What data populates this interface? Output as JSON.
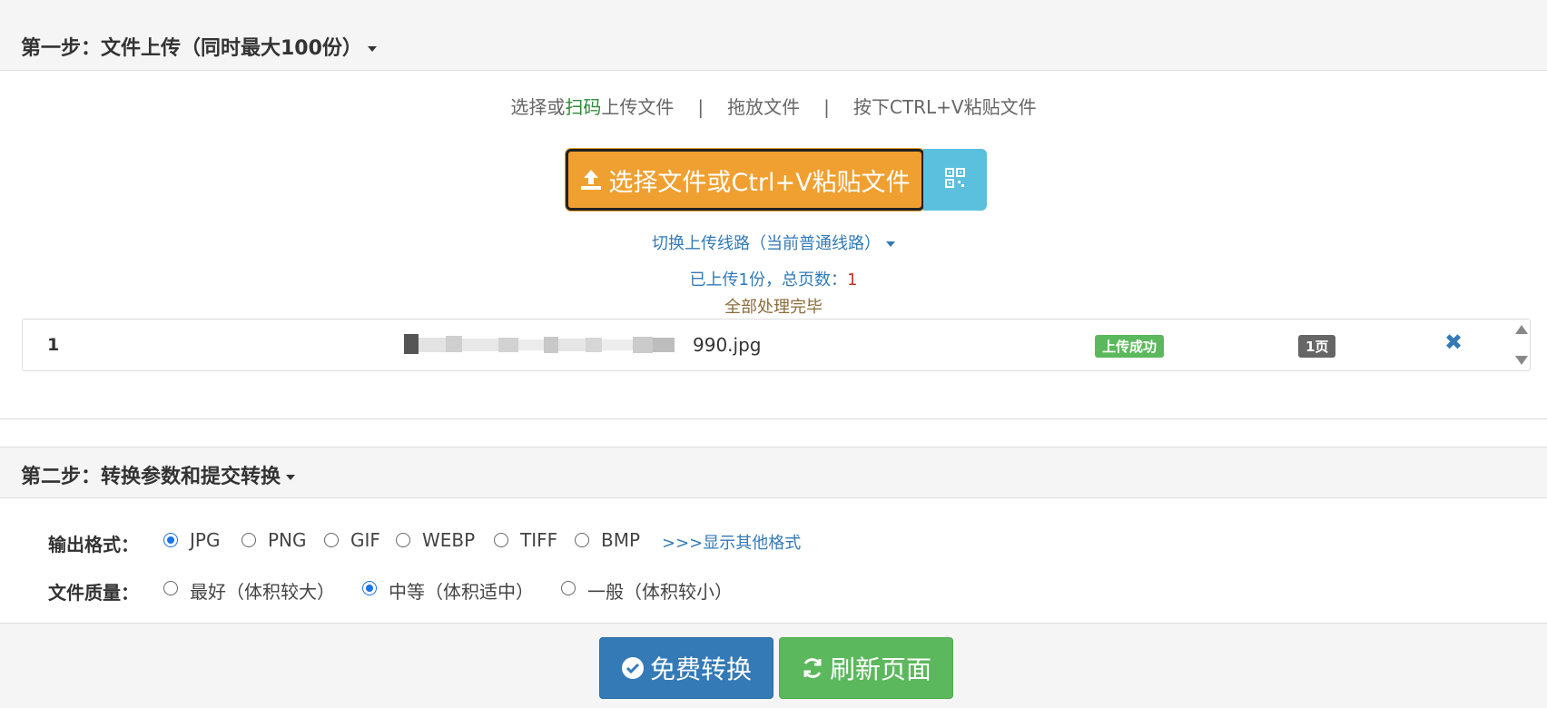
{
  "step1": {
    "title": "第一步：文件上传（同时最大100份）",
    "modes": {
      "choose_prefix": "选择或",
      "scan": "扫码",
      "choose_suffix": "上传文件",
      "sep": "|",
      "drop": "拖放文件",
      "paste": "按下CTRL+V粘贴文件"
    },
    "upload_button": "选择文件或Ctrl+V粘贴文件",
    "switch_line": "切换上传线路（当前普通线路）",
    "upload_status": {
      "prefix": "已上传",
      "count": "1",
      "mid": "份，总页数：",
      "pages": "1"
    },
    "all_done": "全部处理完毕",
    "files": [
      {
        "index": "1",
        "name_suffix": "990.jpg",
        "status": "上传成功",
        "pages": "1页"
      }
    ]
  },
  "step2": {
    "title": "第二步：转换参数和提交转换",
    "output_format": {
      "label": "输出格式：",
      "options": [
        "JPG",
        "PNG",
        "GIF",
        "WEBP",
        "TIFF",
        "BMP"
      ],
      "selected": "JPG",
      "show_more": ">>>显示其他格式"
    },
    "quality": {
      "label": "文件质量：",
      "options": [
        "最好（体积较大）",
        "中等（体积适中）",
        "一般（体积较小）"
      ],
      "selected": "中等（体积适中）"
    }
  },
  "actions": {
    "convert": "免费转换",
    "refresh": "刷新页面"
  },
  "colors": {
    "upload_button": "#f0a030",
    "qr_button": "#5bc0de",
    "convert": "#337ab7",
    "refresh": "#5cb85c",
    "success_badge": "#5cb85c"
  },
  "icons": [
    "upload-icon",
    "qrcode-icon",
    "remove-icon",
    "scroll-up-icon",
    "scroll-down-icon",
    "check-circle-icon",
    "refresh-icon"
  ]
}
